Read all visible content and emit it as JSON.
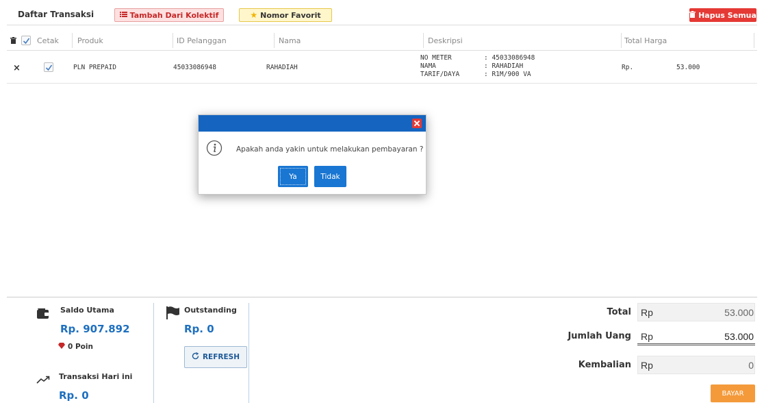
{
  "header": {
    "title": "Daftar Transaksi",
    "kolektif_label": "Tambah Dari Kolektif",
    "favorit_label": "Nomor Favorit",
    "hapus_label": "Hapus Semua"
  },
  "table": {
    "columns": {
      "cetak": "Cetak",
      "produk": "Produk",
      "id_pelanggan": "ID Pelanggan",
      "nama": "Nama",
      "deskripsi": "Deskripsi",
      "total_harga": "Total Harga"
    },
    "rows": [
      {
        "remove_symbol": "×",
        "checked": true,
        "produk": "PLN PREPAID",
        "id_pelanggan": "45033086948",
        "nama": "RAHADIAH",
        "desc_keys": [
          "NO METER",
          "NAMA",
          "TARIF/DAYA"
        ],
        "desc_vals": [
          ": 45033086948",
          ": RAHADIAH",
          ": R1M/900 VA"
        ],
        "currency": "Rp.",
        "total": "53.000"
      }
    ]
  },
  "dialog": {
    "message": "Apakah anda yakin untuk melakukan pembayaran ?",
    "yes_label": "Ya",
    "no_label": "Tidak"
  },
  "summary": {
    "saldo_label": "Saldo Utama",
    "saldo_value": "Rp. 907.892",
    "poin": "0 Poin",
    "transaksi_label": "Transaksi Hari ini",
    "transaksi_value": "Rp. 0",
    "outstanding_label": "Outstanding",
    "outstanding_value": "Rp. 0",
    "refresh_label": "REFRESH",
    "total_label": "Total",
    "total_currency": "Rp",
    "total_value": "53.000",
    "jumlah_label": "Jumlah Uang",
    "jumlah_currency": "Rp",
    "jumlah_value": "53.000",
    "kembalian_label": "Kembalian",
    "kembalian_currency": "Rp",
    "kembalian_value": "0",
    "bayar_label": "BAYAR"
  },
  "colors": {
    "primary": "#1565c0",
    "danger": "#e53935",
    "accent_orange": "#f49a3a",
    "value_blue": "#1e6fbf"
  }
}
